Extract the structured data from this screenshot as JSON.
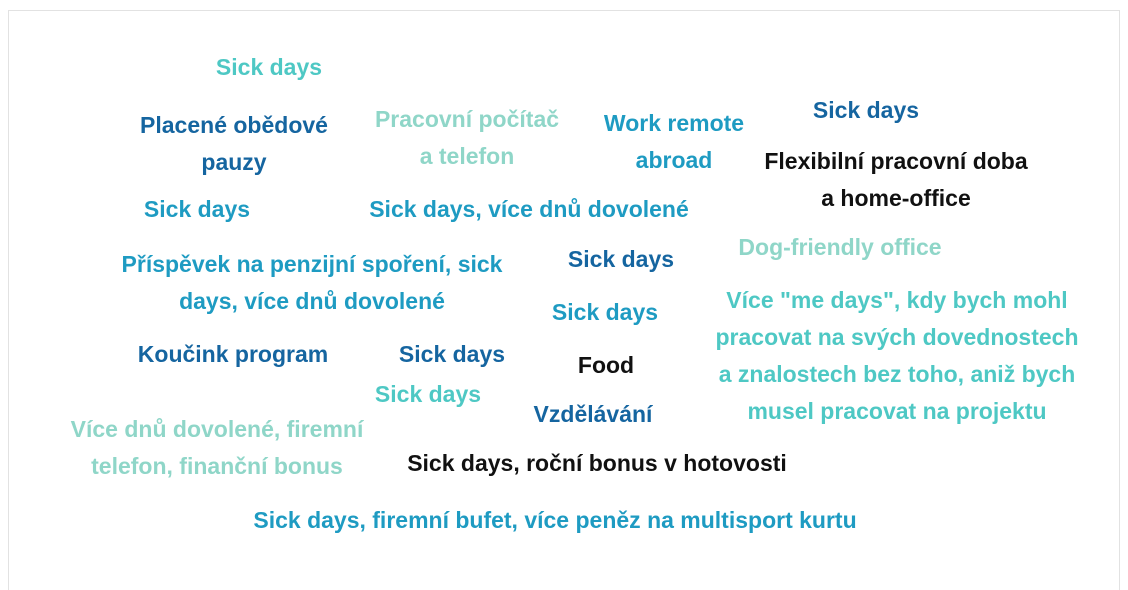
{
  "colors": {
    "dark_blue": "#1565a0",
    "mid_blue": "#1e9bc2",
    "teal": "#4ec8c4",
    "pale_teal": "#8fd6c8",
    "black": "#111111"
  },
  "words": [
    {
      "lines": [
        "Sick days"
      ],
      "color": "teal"
    },
    {
      "lines": [
        "Placené obědové",
        "pauzy"
      ],
      "color": "dark_blue"
    },
    {
      "lines": [
        "Pracovní počítač",
        "a telefon"
      ],
      "color": "pale_teal"
    },
    {
      "lines": [
        "Work remote",
        "abroad"
      ],
      "color": "mid_blue"
    },
    {
      "lines": [
        "Sick days"
      ],
      "color": "dark_blue"
    },
    {
      "lines": [
        "Flexibilní pracovní doba",
        "a home-office"
      ],
      "color": "black"
    },
    {
      "lines": [
        "Sick days"
      ],
      "color": "mid_blue"
    },
    {
      "lines": [
        "Sick days, více dnů dovolené"
      ],
      "color": "mid_blue"
    },
    {
      "lines": [
        "Příspěvek na penzijní spoření, sick",
        "days, více dnů dovolené"
      ],
      "color": "mid_blue"
    },
    {
      "lines": [
        "Sick days"
      ],
      "color": "dark_blue"
    },
    {
      "lines": [
        "Dog-friendly office"
      ],
      "color": "pale_teal"
    },
    {
      "lines": [
        "Sick days"
      ],
      "color": "mid_blue"
    },
    {
      "lines": [
        "Více \"me days\", kdy bych mohl",
        "pracovat na svých dovednostech",
        "a znalostech bez toho, aniž bych",
        "musel pracovat na projektu"
      ],
      "color": "teal"
    },
    {
      "lines": [
        "Koučink program"
      ],
      "color": "dark_blue"
    },
    {
      "lines": [
        "Sick days"
      ],
      "color": "dark_blue"
    },
    {
      "lines": [
        "Food"
      ],
      "color": "black"
    },
    {
      "lines": [
        "Sick days"
      ],
      "color": "teal"
    },
    {
      "lines": [
        "Vzdělávání"
      ],
      "color": "dark_blue"
    },
    {
      "lines": [
        "Více dnů dovolené, firemní",
        "telefon, finanční bonus"
      ],
      "color": "pale_teal"
    },
    {
      "lines": [
        "Sick days, roční bonus v hotovosti"
      ],
      "color": "black"
    },
    {
      "lines": [
        "Sick days, firemní bufet, více peněz na multisport kurtu"
      ],
      "color": "mid_blue"
    }
  ]
}
